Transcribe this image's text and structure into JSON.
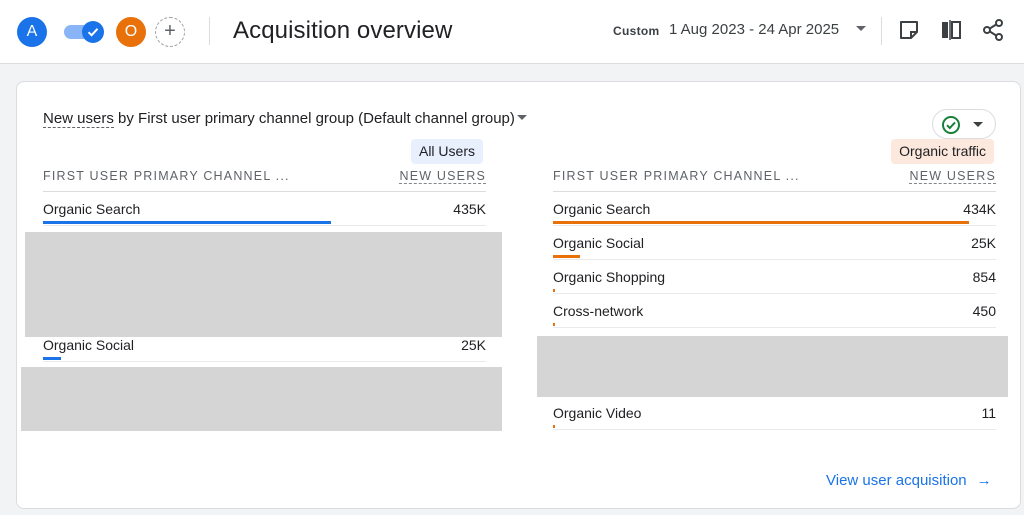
{
  "header": {
    "avatar_a": "A",
    "avatar_o": "O",
    "add_symbol": "+",
    "title": "Acquisition overview",
    "date_chip": "Custom",
    "date_range": "1 Aug 2023 - 24 Apr 2025"
  },
  "card": {
    "title_metric": "New users",
    "title_rest": " by First user primary channel group (Default channel group)",
    "view_link": "View user acquisition",
    "left": {
      "segment": "All Users",
      "dim_header": "FIRST USER PRIMARY CHANNEL ...",
      "metric_header": "NEW USERS",
      "rows": [
        {
          "name": "Organic Search",
          "value": "435K",
          "share": 0.65
        },
        {
          "name": "",
          "value": "",
          "share": 0
        },
        {
          "name": "",
          "value": "",
          "share": 0
        },
        {
          "name": "",
          "value": "",
          "share": 0
        },
        {
          "name": "Organic Social",
          "value": "25K",
          "share": 0.04
        },
        {
          "name": "",
          "value": "",
          "share": 0
        },
        {
          "name": "",
          "value": "",
          "share": 0.01
        }
      ]
    },
    "right": {
      "segment": "Organic traffic",
      "dim_header": "FIRST USER PRIMARY CHANNEL ...",
      "metric_header": "NEW USERS",
      "rows": [
        {
          "name": "Organic Search",
          "value": "434K",
          "share": 0.94
        },
        {
          "name": "Organic Social",
          "value": "25K",
          "share": 0.06
        },
        {
          "name": "Organic Shopping",
          "value": "854",
          "share": 0.004
        },
        {
          "name": "Cross-network",
          "value": "450",
          "share": 0.003
        },
        {
          "name": "",
          "value": "",
          "share": 0
        },
        {
          "name": "",
          "value": "",
          "share": 0.002
        },
        {
          "name": "Organic Video",
          "value": "11",
          "share": 0.001
        }
      ]
    }
  },
  "colors": {
    "accent_blue": "#1a73e8",
    "accent_orange": "#e8710a",
    "success_green": "#188038"
  }
}
